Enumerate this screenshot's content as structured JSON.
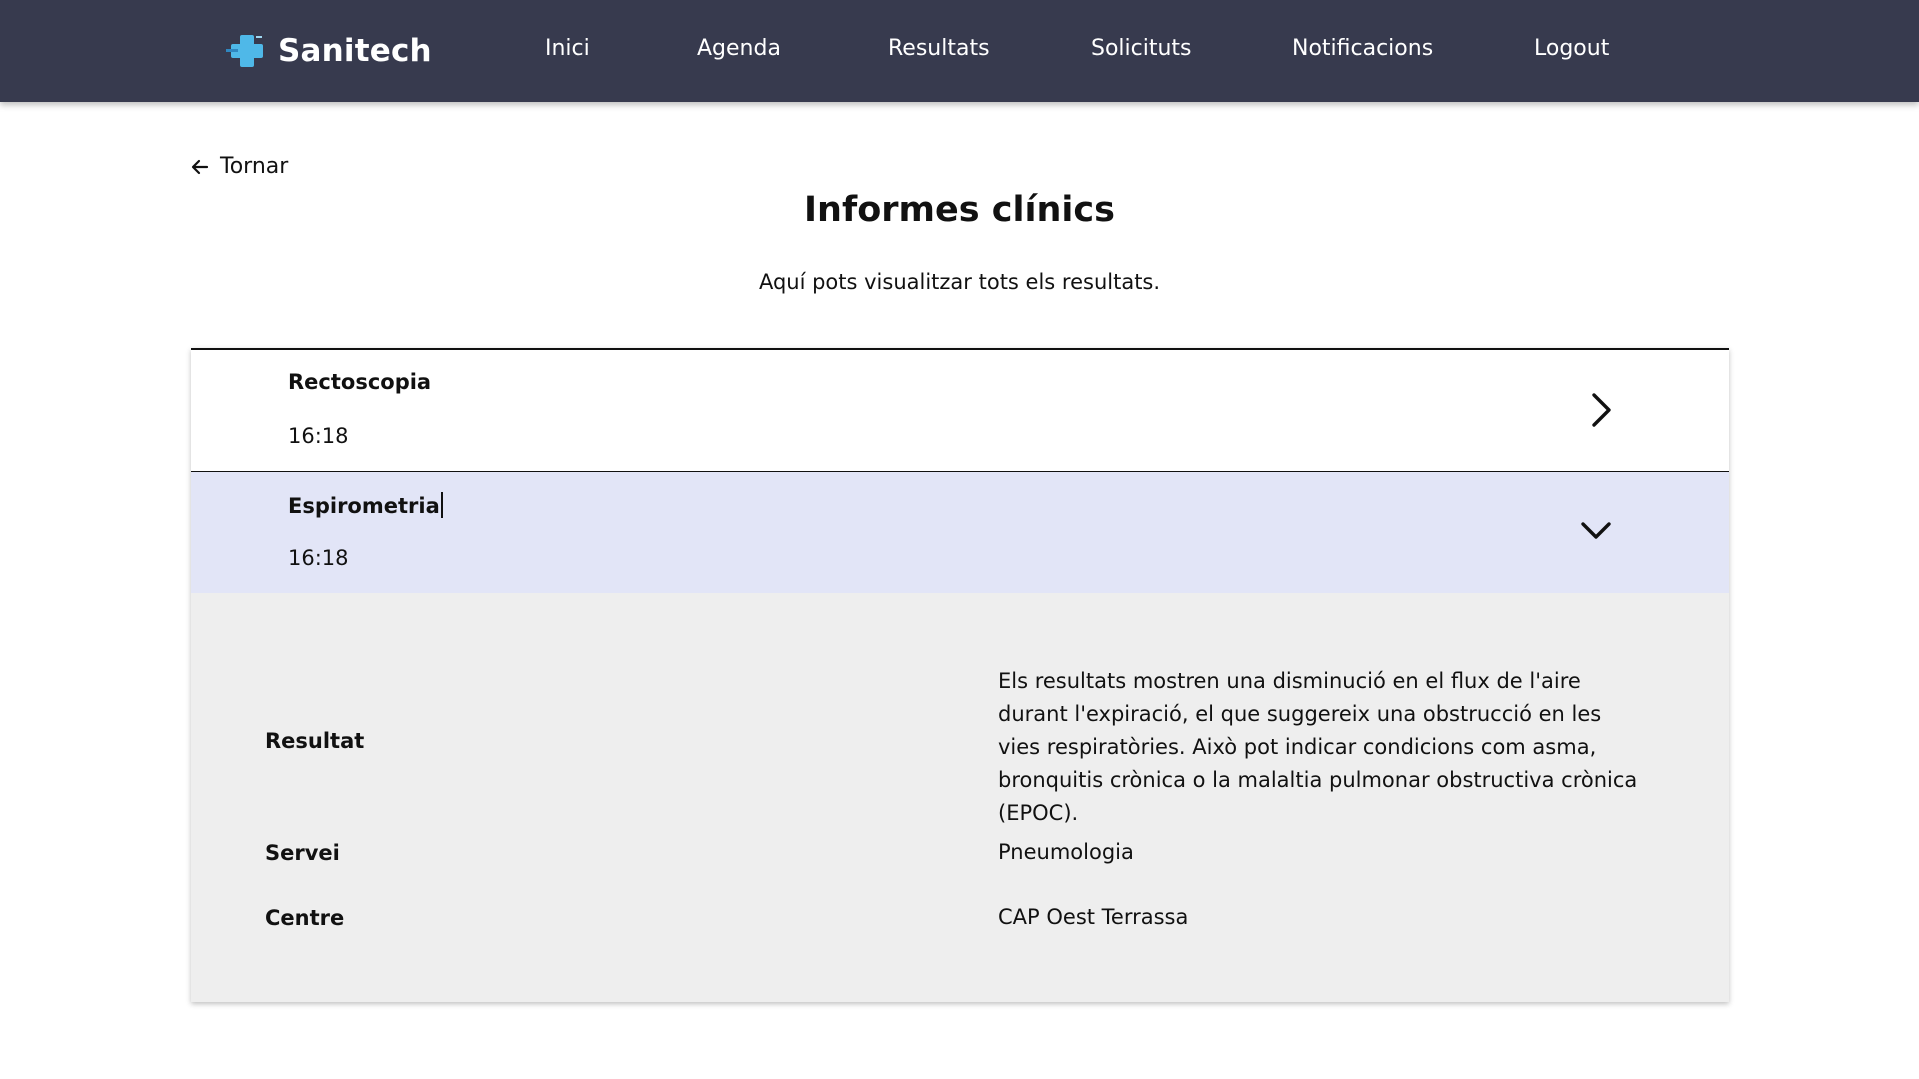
{
  "header": {
    "brand": "Sanitech",
    "nav": [
      "Inici",
      "Agenda",
      "Resultats",
      "Solicituts",
      "Notificacions",
      "Logout"
    ],
    "background": "#373a4e",
    "logo_accent": "#4fb8e8"
  },
  "page": {
    "back_label": "Tornar",
    "title": "Informes clínics",
    "subtitle": "Aquí pots visualitzar tots els resultats."
  },
  "reports": [
    {
      "name": "Rectoscopia",
      "time": "16:18",
      "expanded": false
    },
    {
      "name": "Espirometria",
      "time": "16:18",
      "expanded": true,
      "details": {
        "result_label": "Resultat",
        "result_value": "Els resultats mostren una disminució en el flux de l'aire durant l'expiració, el que suggereix una obstrucció en les vies respiratòries. Això pot indicar condicions com asma, bronquitis crònica o la malaltia pulmonar obstructiva crònica (EPOC).",
        "service_label": "Servei",
        "service_value": "Pneumologia",
        "center_label": "Centre",
        "center_value": "CAP Oest Terrassa"
      }
    }
  ],
  "colors": {
    "expanded_row": "#e2e5f7",
    "panel": "#eeeeee"
  },
  "icons": [
    "cross-logo-icon",
    "arrow-left-icon",
    "chevron-right-icon",
    "chevron-down-icon"
  ]
}
